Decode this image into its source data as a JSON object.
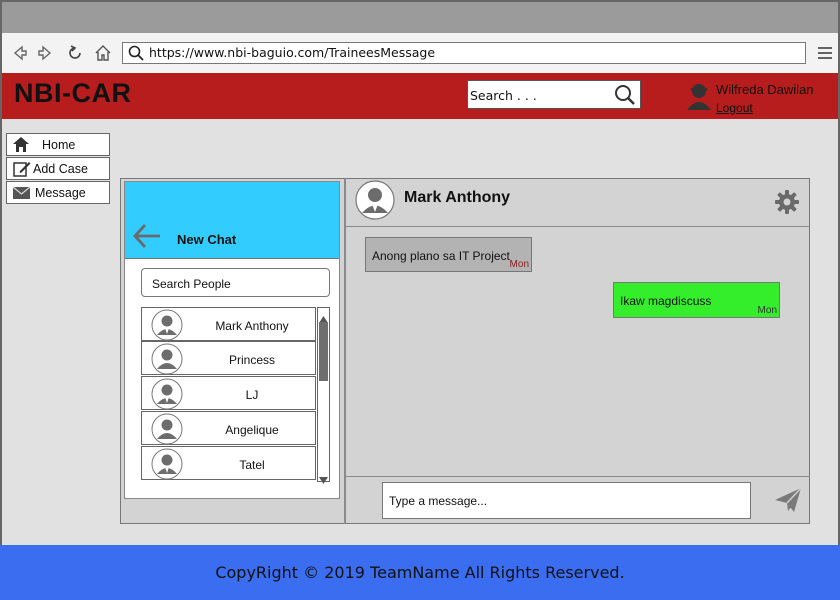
{
  "browser": {
    "url": "https://www.nbi-baguio.com/TraineesMessage",
    "icons": [
      "back-icon",
      "forward-icon",
      "reload-icon",
      "home-icon",
      "search-icon",
      "hamburger-menu-icon"
    ]
  },
  "header": {
    "brand": "NBI-CAR",
    "search_placeholder": "Search . . .",
    "user_name": "Wilfreda Dawilan",
    "logout_label": "Logout",
    "bg_color": "#b71d1d"
  },
  "sidebar": {
    "items": [
      {
        "label": "Home",
        "icon": "home-icon"
      },
      {
        "label": "Add Case",
        "icon": "edit-icon"
      },
      {
        "label": "Message",
        "icon": "envelope-icon"
      }
    ]
  },
  "chat": {
    "contact_name": "Mark Anthony",
    "messages": [
      {
        "text": "Anong plano sa IT Project",
        "day": "Mon",
        "direction": "incoming"
      },
      {
        "text": "Ikaw magdiscuss",
        "day": "Mon",
        "direction": "outgoing"
      }
    ],
    "composer_placeholder": "Type a message...",
    "outgoing_color": "#34ee2c"
  },
  "new_chat": {
    "title": "New Chat",
    "search_placeholder": "Search People",
    "people": [
      "Mark Anthony",
      "Princess",
      "LJ",
      "Angelique",
      "Tatel"
    ],
    "header_color": "#33ccff"
  },
  "footer": {
    "text": "CopyRight © 2019 TeamName All Rights Reserved.",
    "bg_color": "#3a6df0"
  }
}
